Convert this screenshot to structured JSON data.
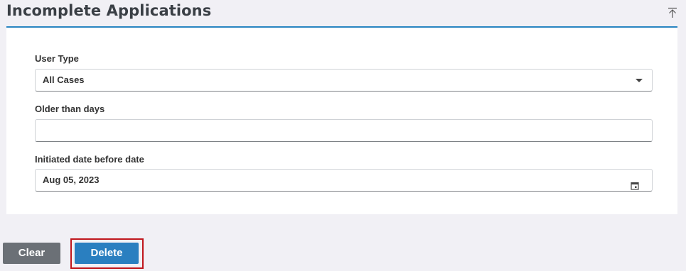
{
  "header": {
    "title": "Incomplete Applications"
  },
  "form": {
    "user_type": {
      "label": "User Type",
      "value": "All Cases"
    },
    "older_than_days": {
      "label": "Older than days",
      "value": ""
    },
    "initiated_date": {
      "label": "Initiated date before date",
      "value": "Aug 05, 2023"
    }
  },
  "actions": {
    "clear_label": "Clear",
    "delete_label": "Delete"
  },
  "icons": {
    "collapse": "collapse-to-top-icon",
    "dropdown": "chevron-down-icon",
    "calendar": "calendar-icon"
  },
  "colors": {
    "accent": "#2a86c2",
    "primary_button": "#2a7fc0",
    "secondary_button": "#6b7076",
    "highlight": "#c0161c"
  }
}
